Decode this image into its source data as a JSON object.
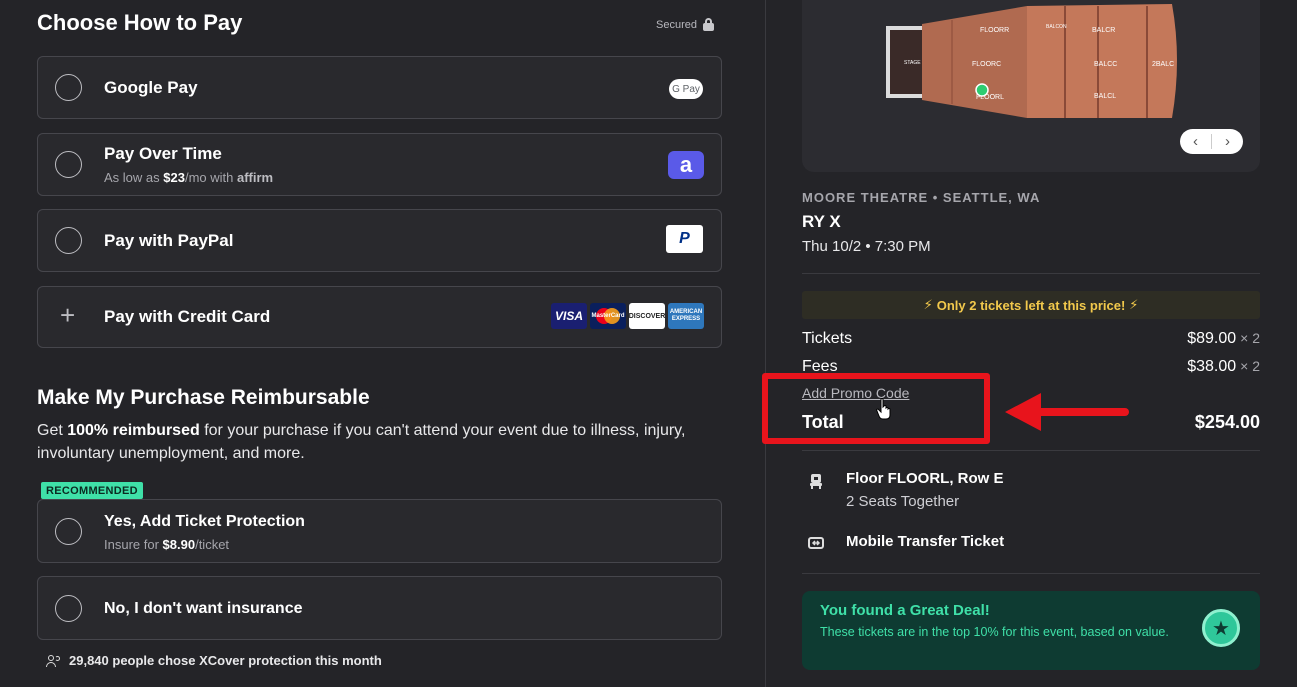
{
  "payment": {
    "title": "Choose How to Pay",
    "secured_label": "Secured",
    "options": [
      {
        "label": "Google Pay",
        "badge": "G Pay"
      },
      {
        "label": "Pay Over Time",
        "sub_prefix": "As low as ",
        "sub_amount": "$23",
        "sub_suffix": "/mo with",
        "brand": "affirm",
        "badge": "a"
      },
      {
        "label": "Pay with PayPal",
        "badge": "P"
      },
      {
        "label": "Pay with Credit Card",
        "plus": "+",
        "cards": [
          "VISA",
          "MasterCard",
          "DISCOVER",
          "AMERICAN EXPRESS"
        ]
      }
    ]
  },
  "reimbursable": {
    "title": "Make My Purchase Reimbursable",
    "desc_prefix": "Get ",
    "desc_bold": "100% reimbursed",
    "desc_suffix": " for your purchase if you can't attend your event due to illness, injury, involuntary unemployment, and more.",
    "recommended_badge": "RECOMMENDED",
    "options": [
      {
        "label": "Yes, Add Ticket Protection",
        "sub_prefix": "Insure for ",
        "sub_amount": "$8.90",
        "sub_suffix": "/ticket"
      },
      {
        "label": "No, I don't want insurance"
      }
    ],
    "social_proof": "29,840 people chose XCover protection this month"
  },
  "seatmap": {
    "sections": [
      "FLOORR",
      "FLOORC",
      "FLOORL",
      "BALCR",
      "BALCC",
      "BALCL",
      "2BALC",
      "STAGE",
      "BALCON"
    ],
    "prev": "‹",
    "next": "›"
  },
  "event": {
    "venue": "MOORE THEATRE • SEATTLE, WA",
    "name": "RY X",
    "date": "Thu 10/2 • 7:30 PM"
  },
  "summary": {
    "alert": "Only 2 tickets left at this price!",
    "alert_icon": "⚡",
    "tickets_label": "Tickets",
    "tickets_price": "$89.00",
    "tickets_mult": "× 2",
    "fees_label": "Fees",
    "fees_price": "$38.00",
    "fees_mult": "× 2",
    "promo_label": "Add Promo Code",
    "total_label": "Total",
    "total_price": "$254.00"
  },
  "seat_info": {
    "title": "Floor FLOORL, Row E",
    "sub": "2 Seats Together",
    "delivery": "Mobile Transfer Ticket"
  },
  "deal": {
    "title": "You found a Great Deal!",
    "text": "These tickets are in the top 10% for this event, based on value.",
    "icon": "★"
  },
  "colors": {
    "background": "#242428",
    "accent_green": "#3fe0a8",
    "alert_yellow": "#f2c94c",
    "annotation_red": "#e8141c"
  }
}
